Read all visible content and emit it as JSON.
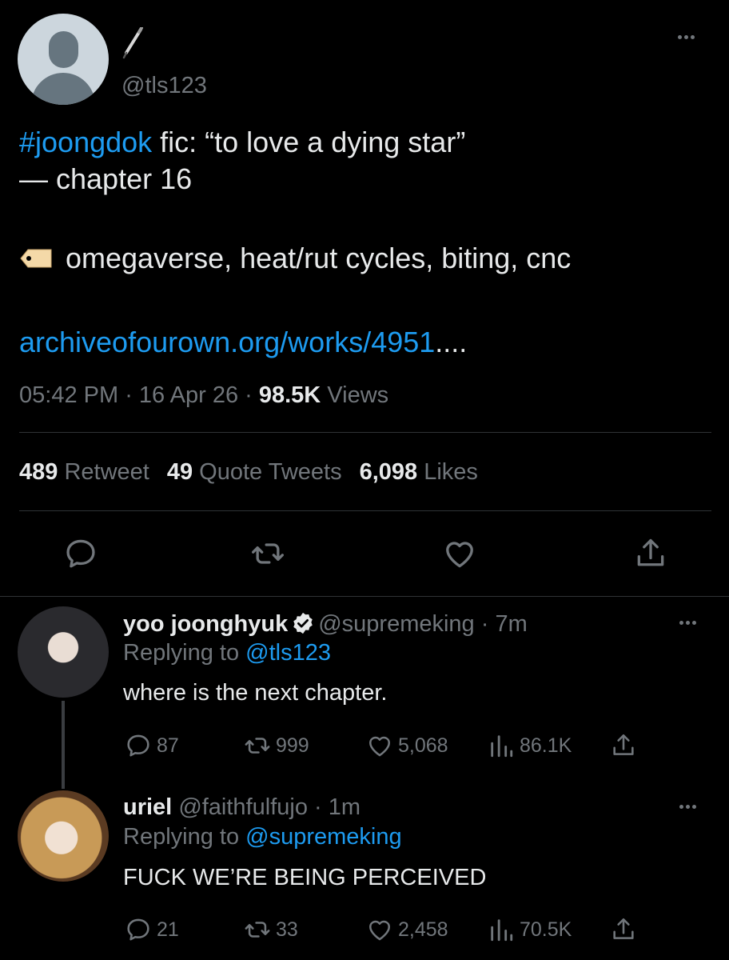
{
  "main_tweet": {
    "handle": "@tls123",
    "hashtag": "#joongdok",
    "line1_rest": " fic: “to love a dying star”",
    "line2": "— chapter 16",
    "tags": "omegaverse, heat/rut cycles, biting, cnc",
    "link_text": "archiveofourown.org/works/4951",
    "link_ellipsis": "....",
    "time": "05:42 PM",
    "sep": " · ",
    "date": "16 Apr 26",
    "views_count": "98.5K",
    "views_label": " Views",
    "retweets_count": "489",
    "retweets_label": " Retweet",
    "quotes_count": "49",
    "quotes_label": " Quote Tweets",
    "likes_count": "6,098",
    "likes_label": " Likes",
    "icons": [
      "pen-icon",
      "tag-icon",
      "reply-icon",
      "retweet-icon",
      "like-icon",
      "share-icon",
      "more-icon"
    ]
  },
  "replies": [
    {
      "name": "yoo joonghyuk",
      "handle": "@supremeking",
      "time": " · 7m",
      "replying_prefix": "Replying to ",
      "replying_to": "@tls123",
      "text": "where is the next chapter.",
      "replies": "87",
      "retweets": "999",
      "likes": "5,068",
      "views": "86.1K"
    },
    {
      "name": "uriel",
      "handle": "@faithfulfujo",
      "time": " · 1m",
      "replying_prefix": "Replying to ",
      "replying_to": "@supremeking",
      "text": "FUCK WE’RE BEING PERCEIVED",
      "replies": "21",
      "retweets": "33",
      "likes": "2,458",
      "views": "70.5K"
    }
  ],
  "colors": {
    "background": "#000000",
    "text": "#e7e9ea",
    "muted": "#71767b",
    "accent": "#1d9bf0",
    "divider": "#2f3336"
  }
}
